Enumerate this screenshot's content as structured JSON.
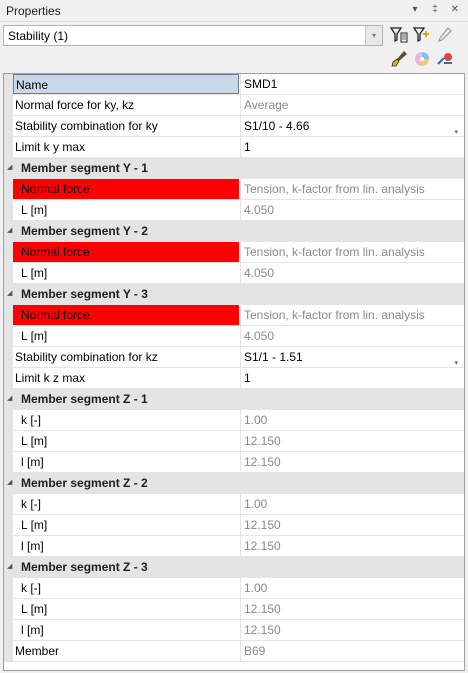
{
  "panel": {
    "title": "Properties"
  },
  "titlebar_buttons": {
    "dropdown": "▾",
    "pin": "‡",
    "close": "✕"
  },
  "combo": {
    "value": "Stability (1)",
    "arrow": "▾"
  },
  "rows": [
    {
      "kind": "prop",
      "name": "Name",
      "value": "SMD1",
      "selected": true
    },
    {
      "kind": "prop",
      "name": "Normal force for ky, kz",
      "value": "Average",
      "readonly": true
    },
    {
      "kind": "prop",
      "name": "Stability combination for ky",
      "value": "S1/10 - 4.66",
      "dropdown": true
    },
    {
      "kind": "prop",
      "name": "Limit k y max",
      "value": "1"
    },
    {
      "kind": "group",
      "name": "Member segment Y - 1"
    },
    {
      "kind": "prop",
      "name": "Normal force",
      "value": "Tension, k-factor from lin. analysis",
      "readonly": true,
      "red": true,
      "sub": true
    },
    {
      "kind": "prop",
      "name": "L [m]",
      "value": "4.050",
      "readonly": true,
      "sub": true
    },
    {
      "kind": "group",
      "name": "Member segment Y - 2"
    },
    {
      "kind": "prop",
      "name": "Normal force",
      "value": "Tension, k-factor from lin. analysis",
      "readonly": true,
      "red": true,
      "sub": true
    },
    {
      "kind": "prop",
      "name": "L [m]",
      "value": "4.050",
      "readonly": true,
      "sub": true
    },
    {
      "kind": "group",
      "name": "Member segment Y - 3"
    },
    {
      "kind": "prop",
      "name": "Normal force",
      "value": "Tension, k-factor from lin. analysis",
      "readonly": true,
      "red": true,
      "sub": true
    },
    {
      "kind": "prop",
      "name": "L [m]",
      "value": "4.050",
      "readonly": true,
      "sub": true
    },
    {
      "kind": "prop",
      "name": "Stability combination for kz",
      "value": "S1/1 - 1.51",
      "dropdown": true
    },
    {
      "kind": "prop",
      "name": "Limit k z max",
      "value": "1"
    },
    {
      "kind": "group",
      "name": "Member segment Z - 1"
    },
    {
      "kind": "prop",
      "name": "k [-]",
      "value": "1.00",
      "readonly": true,
      "sub": true
    },
    {
      "kind": "prop",
      "name": "L [m]",
      "value": "12.150",
      "readonly": true,
      "sub": true
    },
    {
      "kind": "prop",
      "name": "l [m]",
      "value": "12.150",
      "readonly": true,
      "sub": true
    },
    {
      "kind": "group",
      "name": "Member segment Z - 2"
    },
    {
      "kind": "prop",
      "name": "k [-]",
      "value": "1.00",
      "readonly": true,
      "sub": true
    },
    {
      "kind": "prop",
      "name": "L [m]",
      "value": "12.150",
      "readonly": true,
      "sub": true
    },
    {
      "kind": "prop",
      "name": "l [m]",
      "value": "12.150",
      "readonly": true,
      "sub": true
    },
    {
      "kind": "group",
      "name": "Member segment Z - 3"
    },
    {
      "kind": "prop",
      "name": "k [-]",
      "value": "1.00",
      "readonly": true,
      "sub": true
    },
    {
      "kind": "prop",
      "name": "L [m]",
      "value": "12.150",
      "readonly": true,
      "sub": true
    },
    {
      "kind": "prop",
      "name": "l [m]",
      "value": "12.150",
      "readonly": true,
      "sub": true
    },
    {
      "kind": "prop",
      "name": "Member",
      "value": "B69",
      "readonly": true
    }
  ],
  "group_caret": "◢",
  "dropdown_glyph": "▾",
  "colors": {
    "error_red": "#ff0000",
    "selection": "#c9d7e6",
    "readonly_text": "#8a8a8a"
  }
}
